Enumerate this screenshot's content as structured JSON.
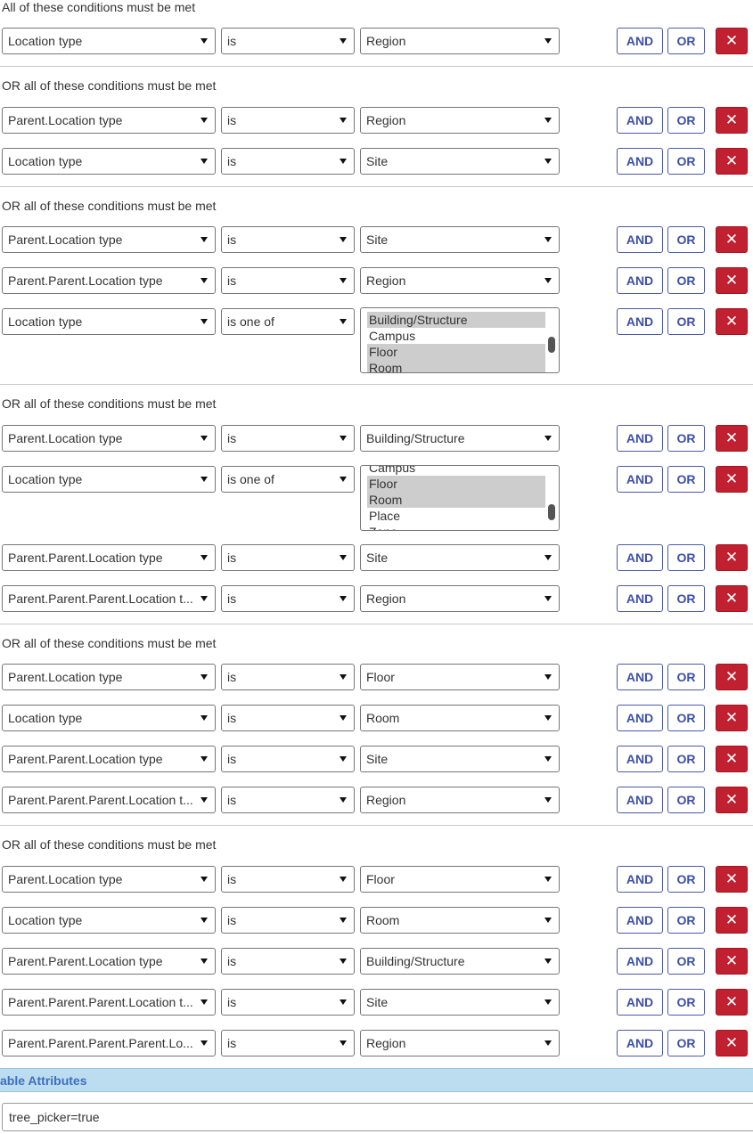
{
  "groups": [
    {
      "title": "All of these conditions must be met",
      "rows": [
        {
          "field": "Location type",
          "operator": "is",
          "value": "Region"
        }
      ]
    },
    {
      "title": "OR all of these conditions must be met",
      "rows": [
        {
          "field": "Parent.Location type",
          "operator": "is",
          "value": "Region"
        },
        {
          "field": "Location type",
          "operator": "is",
          "value": "Site"
        }
      ]
    },
    {
      "title": "OR all of these conditions must be met",
      "rows": [
        {
          "field": "Parent.Location type",
          "operator": "is",
          "value": "Site"
        },
        {
          "field": "Parent.Parent.Location type",
          "operator": "is",
          "value": "Region"
        },
        {
          "field": "Location type",
          "operator": "is one of",
          "options": [
            {
              "label": "Building/Structure",
              "selected": true
            },
            {
              "label": "Campus",
              "selected": false
            },
            {
              "label": "Floor",
              "selected": true
            },
            {
              "label": "Room",
              "selected": true
            }
          ]
        }
      ]
    },
    {
      "title": "OR all of these conditions must be met",
      "rows": [
        {
          "field": "Parent.Location type",
          "operator": "is",
          "value": "Building/Structure"
        },
        {
          "field": "Location type",
          "operator": "is one of",
          "options": [
            {
              "label": "Campus",
              "selected": false
            },
            {
              "label": "Floor",
              "selected": true
            },
            {
              "label": "Room",
              "selected": true
            },
            {
              "label": "Place",
              "selected": false
            },
            {
              "label": "Zone",
              "selected": false
            }
          ]
        },
        {
          "field": "Parent.Parent.Location type",
          "operator": "is",
          "value": "Site"
        },
        {
          "field": "Parent.Parent.Parent.Location t...",
          "operator": "is",
          "value": "Region"
        }
      ]
    },
    {
      "title": "OR all of these conditions must be met",
      "rows": [
        {
          "field": "Parent.Location type",
          "operator": "is",
          "value": "Floor"
        },
        {
          "field": "Location type",
          "operator": "is",
          "value": "Room"
        },
        {
          "field": "Parent.Parent.Location type",
          "operator": "is",
          "value": "Site"
        },
        {
          "field": "Parent.Parent.Parent.Location t...",
          "operator": "is",
          "value": "Region"
        }
      ]
    },
    {
      "title": "OR all of these conditions must be met",
      "rows": [
        {
          "field": "Parent.Location type",
          "operator": "is",
          "value": "Floor"
        },
        {
          "field": "Location type",
          "operator": "is",
          "value": "Room"
        },
        {
          "field": "Parent.Parent.Location type",
          "operator": "is",
          "value": "Building/Structure"
        },
        {
          "field": "Parent.Parent.Parent.Location t...",
          "operator": "is",
          "value": "Site"
        },
        {
          "field": "Parent.Parent.Parent.Parent.Lo...",
          "operator": "is",
          "value": "Region"
        }
      ]
    }
  ],
  "buttons": {
    "and": "AND",
    "or": "OR",
    "delete": "✕"
  },
  "icons": {
    "caret": "caret-down-icon",
    "delete": "close-icon"
  },
  "attributes_section": {
    "label": "able Attributes",
    "value": "tree_picker=true"
  },
  "colors": {
    "accent": "#3d4fa8",
    "danger": "#c0202f",
    "section_bar": "#bcdcf0"
  }
}
